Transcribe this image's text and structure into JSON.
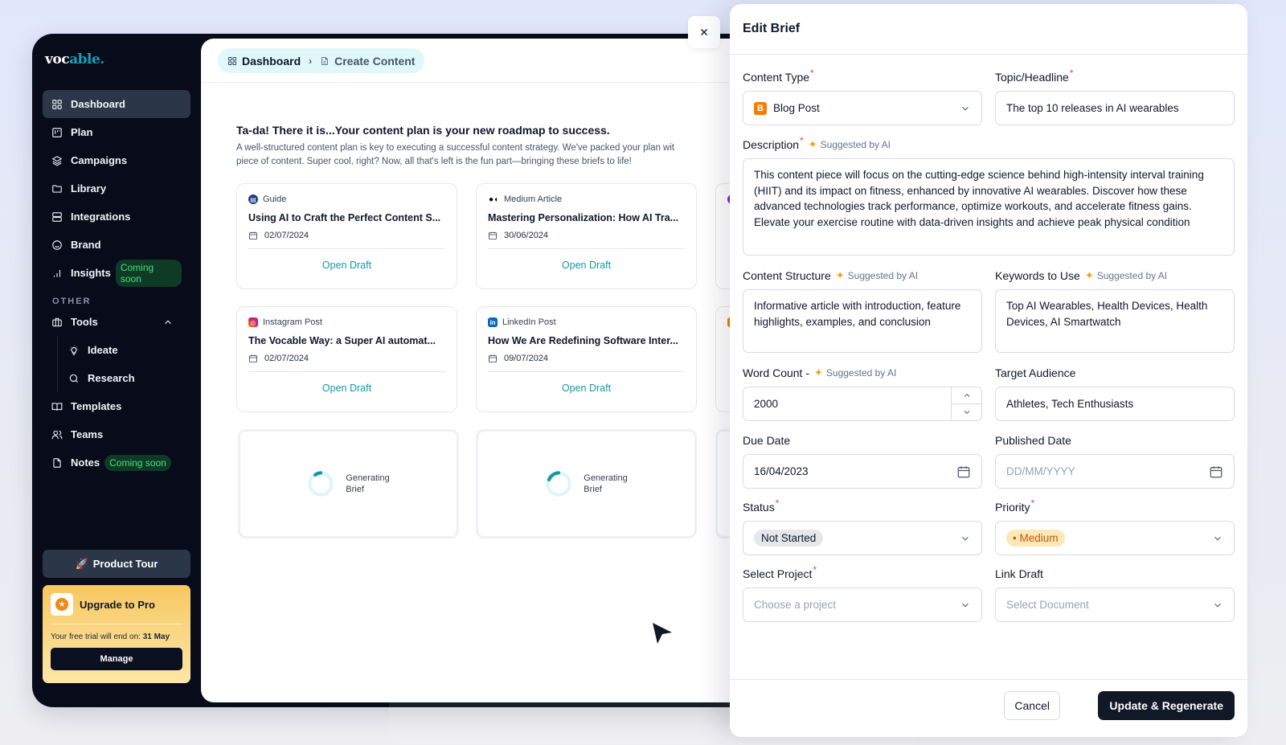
{
  "app": {
    "logo_prefix": "voc",
    "logo_accent": "able.",
    "accent_color": "#14a3b8"
  },
  "sidebar": {
    "items": [
      {
        "label": "Dashboard",
        "icon": "grid-icon",
        "active": true
      },
      {
        "label": "Plan",
        "icon": "board-icon"
      },
      {
        "label": "Campaigns",
        "icon": "layers-icon"
      },
      {
        "label": "Library",
        "icon": "folder-icon"
      },
      {
        "label": "Integrations",
        "icon": "server-icon"
      },
      {
        "label": "Brand",
        "icon": "smile-icon"
      },
      {
        "label": "Insights",
        "icon": "bar-chart-icon",
        "badge": "Coming soon"
      }
    ],
    "section_other": "OTHER",
    "tools": {
      "label": "Tools",
      "icon": "toolbox-icon",
      "expanded": true,
      "children": [
        {
          "label": "Ideate",
          "icon": "lightbulb-icon"
        },
        {
          "label": "Research",
          "icon": "search-icon"
        }
      ]
    },
    "other_items": [
      {
        "label": "Templates",
        "icon": "book-icon"
      },
      {
        "label": "Teams",
        "icon": "users-icon"
      },
      {
        "label": "Notes",
        "icon": "file-icon",
        "badge": "Coming soon"
      }
    ],
    "product_tour": "Product Tour",
    "upgrade": {
      "title": "Upgrade to Pro",
      "trial_text": "Your free trial will end on:",
      "trial_date": "31 May",
      "manage": "Manage"
    }
  },
  "main": {
    "breadcrumb": {
      "home": "Dashboard",
      "current": "Create Content"
    },
    "heading": "Ta-da! There it is...Your content plan is your new roadmap to success.",
    "subtext_line1": "A well-structured content plan is key to executing a successful content strategy. We've packed your plan wit",
    "subtext_line2": "piece of content. Super cool, right? Now, all that's left is the fun part—bringing these briefs to life!",
    "cards": [
      {
        "type": "Guide",
        "title": "Using AI to Craft the Perfect Content S...",
        "date": "02/07/2024",
        "action": "Open Draft"
      },
      {
        "type": "Medium Article",
        "title": "Mastering Personalization: How AI Tra...",
        "date": "30/06/2024",
        "action": "Open Draft"
      },
      {
        "type": "Instagram Post",
        "title": "The Vocable Way: a Super AI automat...",
        "date": "02/07/2024",
        "action": "Open Draft"
      },
      {
        "type": "LinkedIn Post",
        "title": "How We Are Redefining Software Inter...",
        "date": "09/07/2024",
        "action": "Open Draft"
      }
    ],
    "generating": [
      {
        "line1": "Generating",
        "line2": "Brief"
      },
      {
        "line1": "Generating",
        "line2": "Brief"
      }
    ]
  },
  "drawer": {
    "title": "Edit Brief",
    "ai_label": "Suggested by AI",
    "fields": {
      "content_type": {
        "label": "Content Type",
        "value": "Blog Post"
      },
      "topic": {
        "label": "Topic/Headline",
        "value": "The top 10 releases in AI wearables"
      },
      "description": {
        "label": "Description",
        "value": "This content piece will focus on the cutting-edge science behind high-intensity interval training (HIIT) and its impact on fitness, enhanced by innovative AI wearables. Discover how these advanced technologies track performance, optimize workouts, and accelerate fitness gains. Elevate your exercise routine with data-driven insights and achieve peak physical condition"
      },
      "structure": {
        "label": "Content Structure",
        "value": "Informative article with introduction, feature highlights, examples, and conclusion"
      },
      "keywords": {
        "label": "Keywords to Use",
        "value": "Top AI Wearables, Health Devices, Health Devices, AI Smartwatch"
      },
      "word_count": {
        "label": "Word Count -",
        "value": "2000"
      },
      "audience": {
        "label": "Target Audience",
        "value": "Athletes, Tech Enthusiasts"
      },
      "due_date": {
        "label": "Due Date",
        "value": "16/04/2023"
      },
      "published_date": {
        "label": "Published Date",
        "placeholder": "DD/MM/YYYY"
      },
      "status": {
        "label": "Status",
        "value": "Not Started"
      },
      "priority": {
        "label": "Priority",
        "value": "Medium",
        "color": "#c2570c"
      },
      "project": {
        "label": "Select Project",
        "placeholder": "Choose a project"
      },
      "link_draft": {
        "label": "Link Draft",
        "placeholder": "Select Document"
      }
    },
    "cancel": "Cancel",
    "submit": "Update & Regenerate"
  }
}
